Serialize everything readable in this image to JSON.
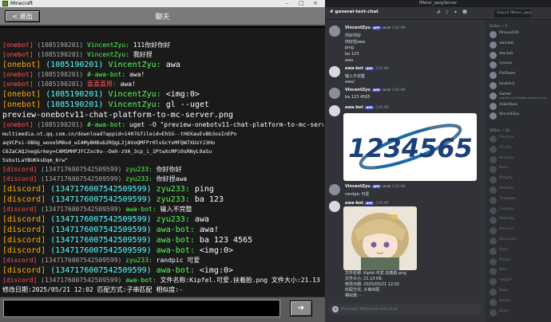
{
  "minecraft": {
    "window_title": "Minecraft",
    "back_label": "< 退出",
    "screen_title": "聊天",
    "send_icon": "arrow-right-icon",
    "chat_lines": [
      {
        "size": "",
        "segs": [
          {
            "c": "t-red",
            "t": "[onebot]"
          },
          {
            "c": "t-gid",
            "t": " (1085190201) "
          },
          {
            "c": "t-name",
            "t": "VincentZyu:"
          },
          {
            "c": "t-w",
            "t": " 111你好你好"
          }
        ]
      },
      {
        "size": "",
        "segs": [
          {
            "c": "t-red",
            "t": "[onebot]"
          },
          {
            "c": "t-gid",
            "t": " (1085190201) "
          },
          {
            "c": "t-name",
            "t": "VincentZyu:"
          },
          {
            "c": "t-w",
            "t": " 我好捏"
          }
        ]
      },
      {
        "size": "big",
        "segs": [
          {
            "c": "t-onebot",
            "t": "[onebot]"
          },
          {
            "c": "t-id",
            "t": " (1085190201) "
          },
          {
            "c": "t-name",
            "t": "VincentZyu:"
          },
          {
            "c": "t-w",
            "t": " awa"
          }
        ]
      },
      {
        "size": "",
        "segs": [
          {
            "c": "t-red",
            "t": "[onebot]"
          },
          {
            "c": "t-gid",
            "t": " (1085190201) "
          },
          {
            "c": "t-bot",
            "t": "#-awa-bot:"
          },
          {
            "c": "t-w",
            "t": " awa!"
          }
        ]
      },
      {
        "size": "",
        "segs": [
          {
            "c": "t-red",
            "t": "[onebot]"
          },
          {
            "c": "t-gid",
            "t": " (1085190201) "
          },
          {
            "c": "t-red",
            "t": "喜喜喜用:"
          },
          {
            "c": "t-w",
            "t": " awa!"
          }
        ]
      },
      {
        "size": "big",
        "segs": [
          {
            "c": "t-onebot",
            "t": "[onebot]"
          },
          {
            "c": "t-id",
            "t": " (1085190201) "
          },
          {
            "c": "t-name",
            "t": "VincentZyu:"
          },
          {
            "c": "t-w",
            "t": " <img:0>"
          }
        ]
      },
      {
        "size": "big",
        "segs": [
          {
            "c": "t-onebot",
            "t": "[onebot]"
          },
          {
            "c": "t-id",
            "t": " (1085190201) "
          },
          {
            "c": "t-name",
            "t": "VincentZyu:"
          },
          {
            "c": "t-w",
            "t": " gl --uget"
          }
        ]
      },
      {
        "size": "big",
        "segs": [
          {
            "c": "t-w",
            "t": "preview-onebotv11-chat-platform-to-mc-server.png"
          }
        ]
      },
      {
        "size": "",
        "segs": [
          {
            "c": "t-red",
            "t": "[onebot]"
          },
          {
            "c": "t-gid",
            "t": " (1085190201) "
          },
          {
            "c": "t-bot",
            "t": "#-awa-bot:"
          },
          {
            "c": "t-w",
            "t": " uget -O \"preview-onebotv11-chat-platform-to-mc-server.png\" \"https://"
          }
        ]
      },
      {
        "size": "sm",
        "segs": [
          {
            "c": "t-w",
            "t": "multimedia.nt.qq.com.cn/download?appid=1407&fileid=EhSG--tHOXauEvBb3osInEPn"
          }
        ]
      },
      {
        "size": "sm",
        "segs": [
          {
            "c": "t-w",
            "t": "aqVCPxi-OBOg_wooo5M8vd_wIAMyBHBub2RQgL2jAVoQMFPr0lvGcYxMFQW7XUsYJ3Ho"
          }
        ]
      },
      {
        "size": "sm",
        "segs": [
          {
            "c": "t-w",
            "t": "C6ZaCAQJneg&rkey=CAMSMHPJFCZxc9u--Deh-zVA_3cp_i_1PtwXcMPi0sRNyL9aSu"
          }
        ]
      },
      {
        "size": "sm",
        "segs": [
          {
            "c": "t-w",
            "t": "SsbstLaYBUKksDqm_6rw\""
          }
        ]
      },
      {
        "size": "",
        "segs": [
          {
            "c": "t-red",
            "t": "[discord]"
          },
          {
            "c": "t-gid",
            "t": " (1347176007542509599) "
          },
          {
            "c": "t-bot",
            "t": "zyu233:"
          },
          {
            "c": "t-w",
            "t": " 你好你好"
          }
        ]
      },
      {
        "size": "",
        "segs": [
          {
            "c": "t-red",
            "t": "[discord]"
          },
          {
            "c": "t-gid",
            "t": " (1347176007542509599) "
          },
          {
            "c": "t-bot",
            "t": "zyu233:"
          },
          {
            "c": "t-w",
            "t": " 你好捏awa"
          }
        ]
      },
      {
        "size": "big",
        "segs": [
          {
            "c": "t-discord",
            "t": "[discord]"
          },
          {
            "c": "t-id",
            "t": " (1347176007542509599) "
          },
          {
            "c": "t-name",
            "t": "zyu233:"
          },
          {
            "c": "t-w",
            "t": " ping"
          }
        ]
      },
      {
        "size": "big",
        "segs": [
          {
            "c": "t-discord",
            "t": "[discord]"
          },
          {
            "c": "t-id",
            "t": " (1347176007542509599) "
          },
          {
            "c": "t-name",
            "t": "zyu233:"
          },
          {
            "c": "t-w",
            "t": " ba 123"
          }
        ]
      },
      {
        "size": "",
        "segs": [
          {
            "c": "t-red",
            "t": "[discord]"
          },
          {
            "c": "t-gid",
            "t": " (1347176007542509599) "
          },
          {
            "c": "t-bot",
            "t": "awa-bot:"
          },
          {
            "c": "t-w",
            "t": " 输入不完整"
          }
        ]
      },
      {
        "size": "big",
        "segs": [
          {
            "c": "t-discord",
            "t": "[discord]"
          },
          {
            "c": "t-id",
            "t": " (1347176007542509599) "
          },
          {
            "c": "t-name",
            "t": "zyu233:"
          },
          {
            "c": "t-w",
            "t": " awa"
          }
        ]
      },
      {
        "size": "big",
        "segs": [
          {
            "c": "t-discord",
            "t": "[discord]"
          },
          {
            "c": "t-id",
            "t": " (1347176007542509599) "
          },
          {
            "c": "t-name",
            "t": "awa-bot:"
          },
          {
            "c": "t-w",
            "t": " awa!"
          }
        ]
      },
      {
        "size": "big",
        "segs": [
          {
            "c": "t-discord",
            "t": "[discord]"
          },
          {
            "c": "t-id",
            "t": " (1347176007542509599) "
          },
          {
            "c": "t-name",
            "t": "awa-bot:"
          },
          {
            "c": "t-w",
            "t": " ba 123 4565"
          }
        ]
      },
      {
        "size": "big",
        "segs": [
          {
            "c": "t-discord",
            "t": "[discord]"
          },
          {
            "c": "t-id",
            "t": " (1347176007542509599) "
          },
          {
            "c": "t-name",
            "t": "awa-bot:"
          },
          {
            "c": "t-w",
            "t": " <img:0>"
          }
        ]
      },
      {
        "size": "",
        "segs": [
          {
            "c": "t-red",
            "t": "[discord]"
          },
          {
            "c": "t-gid",
            "t": " (1347176007542509599) "
          },
          {
            "c": "t-bot",
            "t": "zyu233:"
          },
          {
            "c": "t-w",
            "t": " randpic 可爱"
          }
        ]
      },
      {
        "size": "big",
        "segs": [
          {
            "c": "t-discord",
            "t": "[discord]"
          },
          {
            "c": "t-id",
            "t": " (1347176007542509599) "
          },
          {
            "c": "t-name",
            "t": "awa-bot:"
          },
          {
            "c": "t-w",
            "t": " <img:0>"
          }
        ]
      },
      {
        "size": "",
        "segs": [
          {
            "c": "t-red",
            "t": "[discord]"
          },
          {
            "c": "t-gid",
            "t": " (1347176007542509599) "
          },
          {
            "c": "t-bot",
            "t": "awa-bot:"
          },
          {
            "c": "t-w",
            "t": " 文件名称:Kipfel.可爱.扶着脸.png 文件大小:21.13 KB"
          }
        ]
      },
      {
        "size": "",
        "segs": [
          {
            "c": "t-w",
            "t": "修改日期:2025/05/21 12:02 匹配方式:子串匹配 相似度:-"
          }
        ]
      }
    ]
  },
  "discord": {
    "window_title": "fMeter_qwq|Server",
    "channel": "# general-text-chat",
    "search_placeholder": "Search fMeter_qwq|Server",
    "composer_placeholder": "Message #general-text-chat",
    "messages": [
      {
        "author": "VincentZyu",
        "tag": "APP",
        "mc": "MCSR",
        "time": "2:40 AM",
        "lines": [
          "你好你好",
          "你好捏awa",
          "ping",
          "ba 123",
          "awa"
        ]
      },
      {
        "author": "awa-bot",
        "tag": "APP",
        "mc": "",
        "time": "2:40 AM",
        "lines": [
          "输入不完整",
          "awa!"
        ]
      },
      {
        "author": "VincentZyu",
        "tag": "APP",
        "mc": "MCSR",
        "time": "2:40 AM",
        "lines": [
          "ba 123 4565"
        ]
      },
      {
        "author": "awa-bot",
        "tag": "APP",
        "mc": "",
        "time": "2:40 AM",
        "lines": []
      },
      {
        "author": "VincentZyu",
        "tag": "APP",
        "mc": "MCSR",
        "time": "2:40 AM",
        "lines": [
          "randpic 可爱"
        ]
      },
      {
        "author": "awa-bot",
        "tag": "APP",
        "mc": "",
        "time": "2:40 AM",
        "lines": []
      }
    ],
    "logo_text": "1234565",
    "file_info": [
      "文件名称: Kipfel.可爱.扶着脸.png",
      "文件大小: 21.13 KB",
      "修改日期: 2025/05/21 12:02",
      "匹配方式: 子串匹配",
      "相似度: -"
    ],
    "online_header": "Online — 9",
    "offline_header": "Offline — 18",
    "members_online": [
      "Mrsxxx030",
      "awa-bot",
      "dev-bot",
      "ryuuuu",
      "FileTewer",
      "landvfu1",
      "Gamer",
      "mikki9you",
      "VincentZyu"
    ],
    "members_online_status": [
      "",
      "",
      "",
      "",
      "",
      "",
      "subtitle is the better portal is this...",
      "",
      ""
    ],
    "members_offline": [
      "Flexsym",
      "HT-Oliv",
      "IIvxacbz",
      "Bonn",
      "Dirtyfig",
      "Allobeer",
      "Tinkyway",
      "Livaplus",
      "Shanchy",
      "Alex-mc",
      "Aboundio",
      "Sumi",
      "Fineer",
      "Yoru",
      "sdeger",
      "Haku",
      "bunny",
      "Zyph"
    ]
  }
}
